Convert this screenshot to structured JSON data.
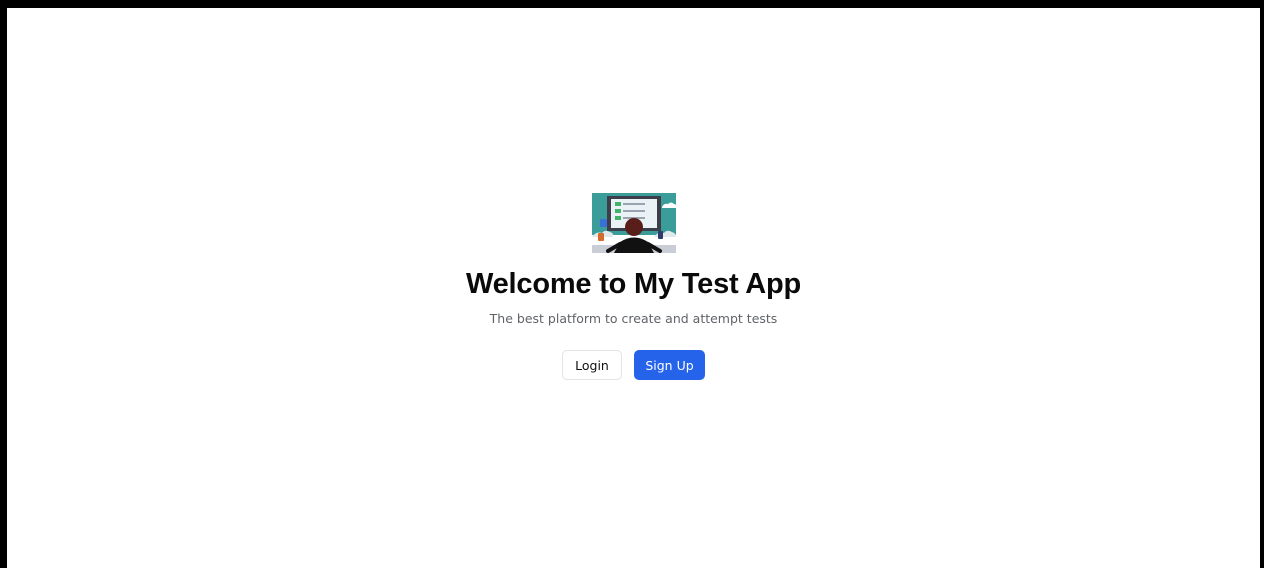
{
  "hero": {
    "illustration": "person-at-computer-checklist-illustration",
    "title": "Welcome to My Test App",
    "subtitle": "The best platform to create and attempt tests"
  },
  "actions": {
    "login_label": "Login",
    "signup_label": "Sign Up"
  },
  "colors": {
    "page_border": "#000000",
    "background": "#ffffff",
    "primary": "#2563eb",
    "title_text": "#0a0a0a",
    "subtitle_text": "#5f6368",
    "illustration_teal": "#3a9d9a"
  }
}
